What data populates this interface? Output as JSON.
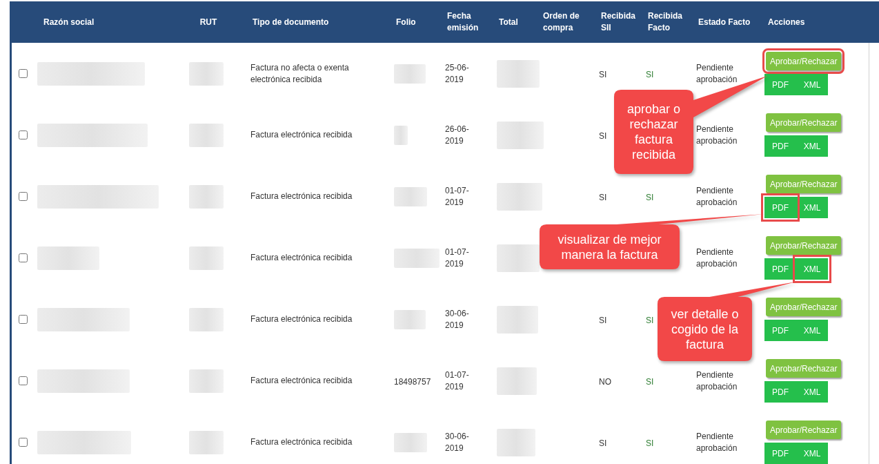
{
  "table": {
    "columns": [
      "Razón social",
      "RUT",
      "Tipo de documento",
      "Folio",
      "Fecha emisión",
      "Total",
      "Orden de compra",
      "Recibida SII",
      "Recibida Facto",
      "Estado Facto",
      "Acciones"
    ],
    "rows": [
      {
        "checked": false,
        "tipo": "Factura no afecta o exenta electrónica recibida",
        "fecha": "25-06-2019",
        "sii": "SI",
        "facto": "SI",
        "estado": "Pendiente aprobación",
        "actions": [
          {
            "kind": "approve",
            "label": "Aprobar/Rechazar",
            "highlighted": true
          },
          {
            "kind": "file",
            "label": "PDF",
            "highlighted": false
          },
          {
            "kind": "file",
            "label": "XML",
            "highlighted": false
          }
        ]
      },
      {
        "checked": false,
        "tipo": "Factura electrónica recibida",
        "fecha": "26-06-2019",
        "sii": "SI",
        "estado": "Pendiente aprobación",
        "actions": [
          {
            "kind": "approve",
            "label": "Aprobar/Rechazar",
            "highlighted": false
          },
          {
            "kind": "file",
            "label": "PDF",
            "highlighted": false
          },
          {
            "kind": "file",
            "label": "XML",
            "highlighted": false
          }
        ]
      },
      {
        "checked": false,
        "tipo": "Factura electrónica recibida",
        "fecha": "01-07-2019",
        "sii": "SI",
        "facto": "SI",
        "estado": "Pendiente aprobación",
        "actions": [
          {
            "kind": "approve",
            "label": "Aprobar/Rechazar",
            "highlighted": false
          },
          {
            "kind": "file",
            "label": "PDF",
            "highlighted": true
          },
          {
            "kind": "file",
            "label": "XML",
            "highlighted": false
          }
        ]
      },
      {
        "checked": false,
        "tipo": "Factura electrónica recibida",
        "fecha": "01-07-2019",
        "estado": "Pendiente aprobación",
        "actions": [
          {
            "kind": "approve",
            "label": "Aprobar/Rechazar",
            "highlighted": false
          },
          {
            "kind": "file",
            "label": "PDF",
            "highlighted": false
          },
          {
            "kind": "file",
            "label": "XML",
            "highlighted": true
          }
        ]
      },
      {
        "checked": false,
        "tipo": "Factura electrónica recibida",
        "fecha": "30-06-2019",
        "sii": "SI",
        "facto": "SI",
        "actions": [
          {
            "kind": "approve",
            "label": "Aprobar/Rechazar",
            "highlighted": false
          },
          {
            "kind": "file",
            "label": "PDF",
            "highlighted": false
          },
          {
            "kind": "file",
            "label": "XML",
            "highlighted": false
          }
        ]
      },
      {
        "checked": false,
        "tipo": "Factura electrónica recibida",
        "folio": "18498757",
        "fecha": "01-07-2019",
        "sii": "NO",
        "facto": "SI",
        "estado": "Pendiente aprobación",
        "actions": [
          {
            "kind": "approve",
            "label": "Aprobar/Rechazar",
            "highlighted": false
          },
          {
            "kind": "file",
            "label": "PDF",
            "highlighted": false
          },
          {
            "kind": "file",
            "label": "XML",
            "highlighted": false
          }
        ]
      },
      {
        "checked": false,
        "tipo": "Factura electrónica recibida",
        "fecha": "30-06-2019",
        "sii": "SI",
        "facto": "SI",
        "estado": "Pendiente aprobación",
        "actions": [
          {
            "kind": "approve",
            "label": "Aprobar/Rechazar",
            "highlighted": false
          },
          {
            "kind": "file",
            "label": "PDF",
            "highlighted": false
          },
          {
            "kind": "file",
            "label": "XML",
            "highlighted": false
          }
        ]
      }
    ]
  },
  "callouts": [
    "aprobar o rechazar factura recibida",
    "visualizar de mejor manera la factura",
    "ver detalle o cogido de la factura"
  ]
}
